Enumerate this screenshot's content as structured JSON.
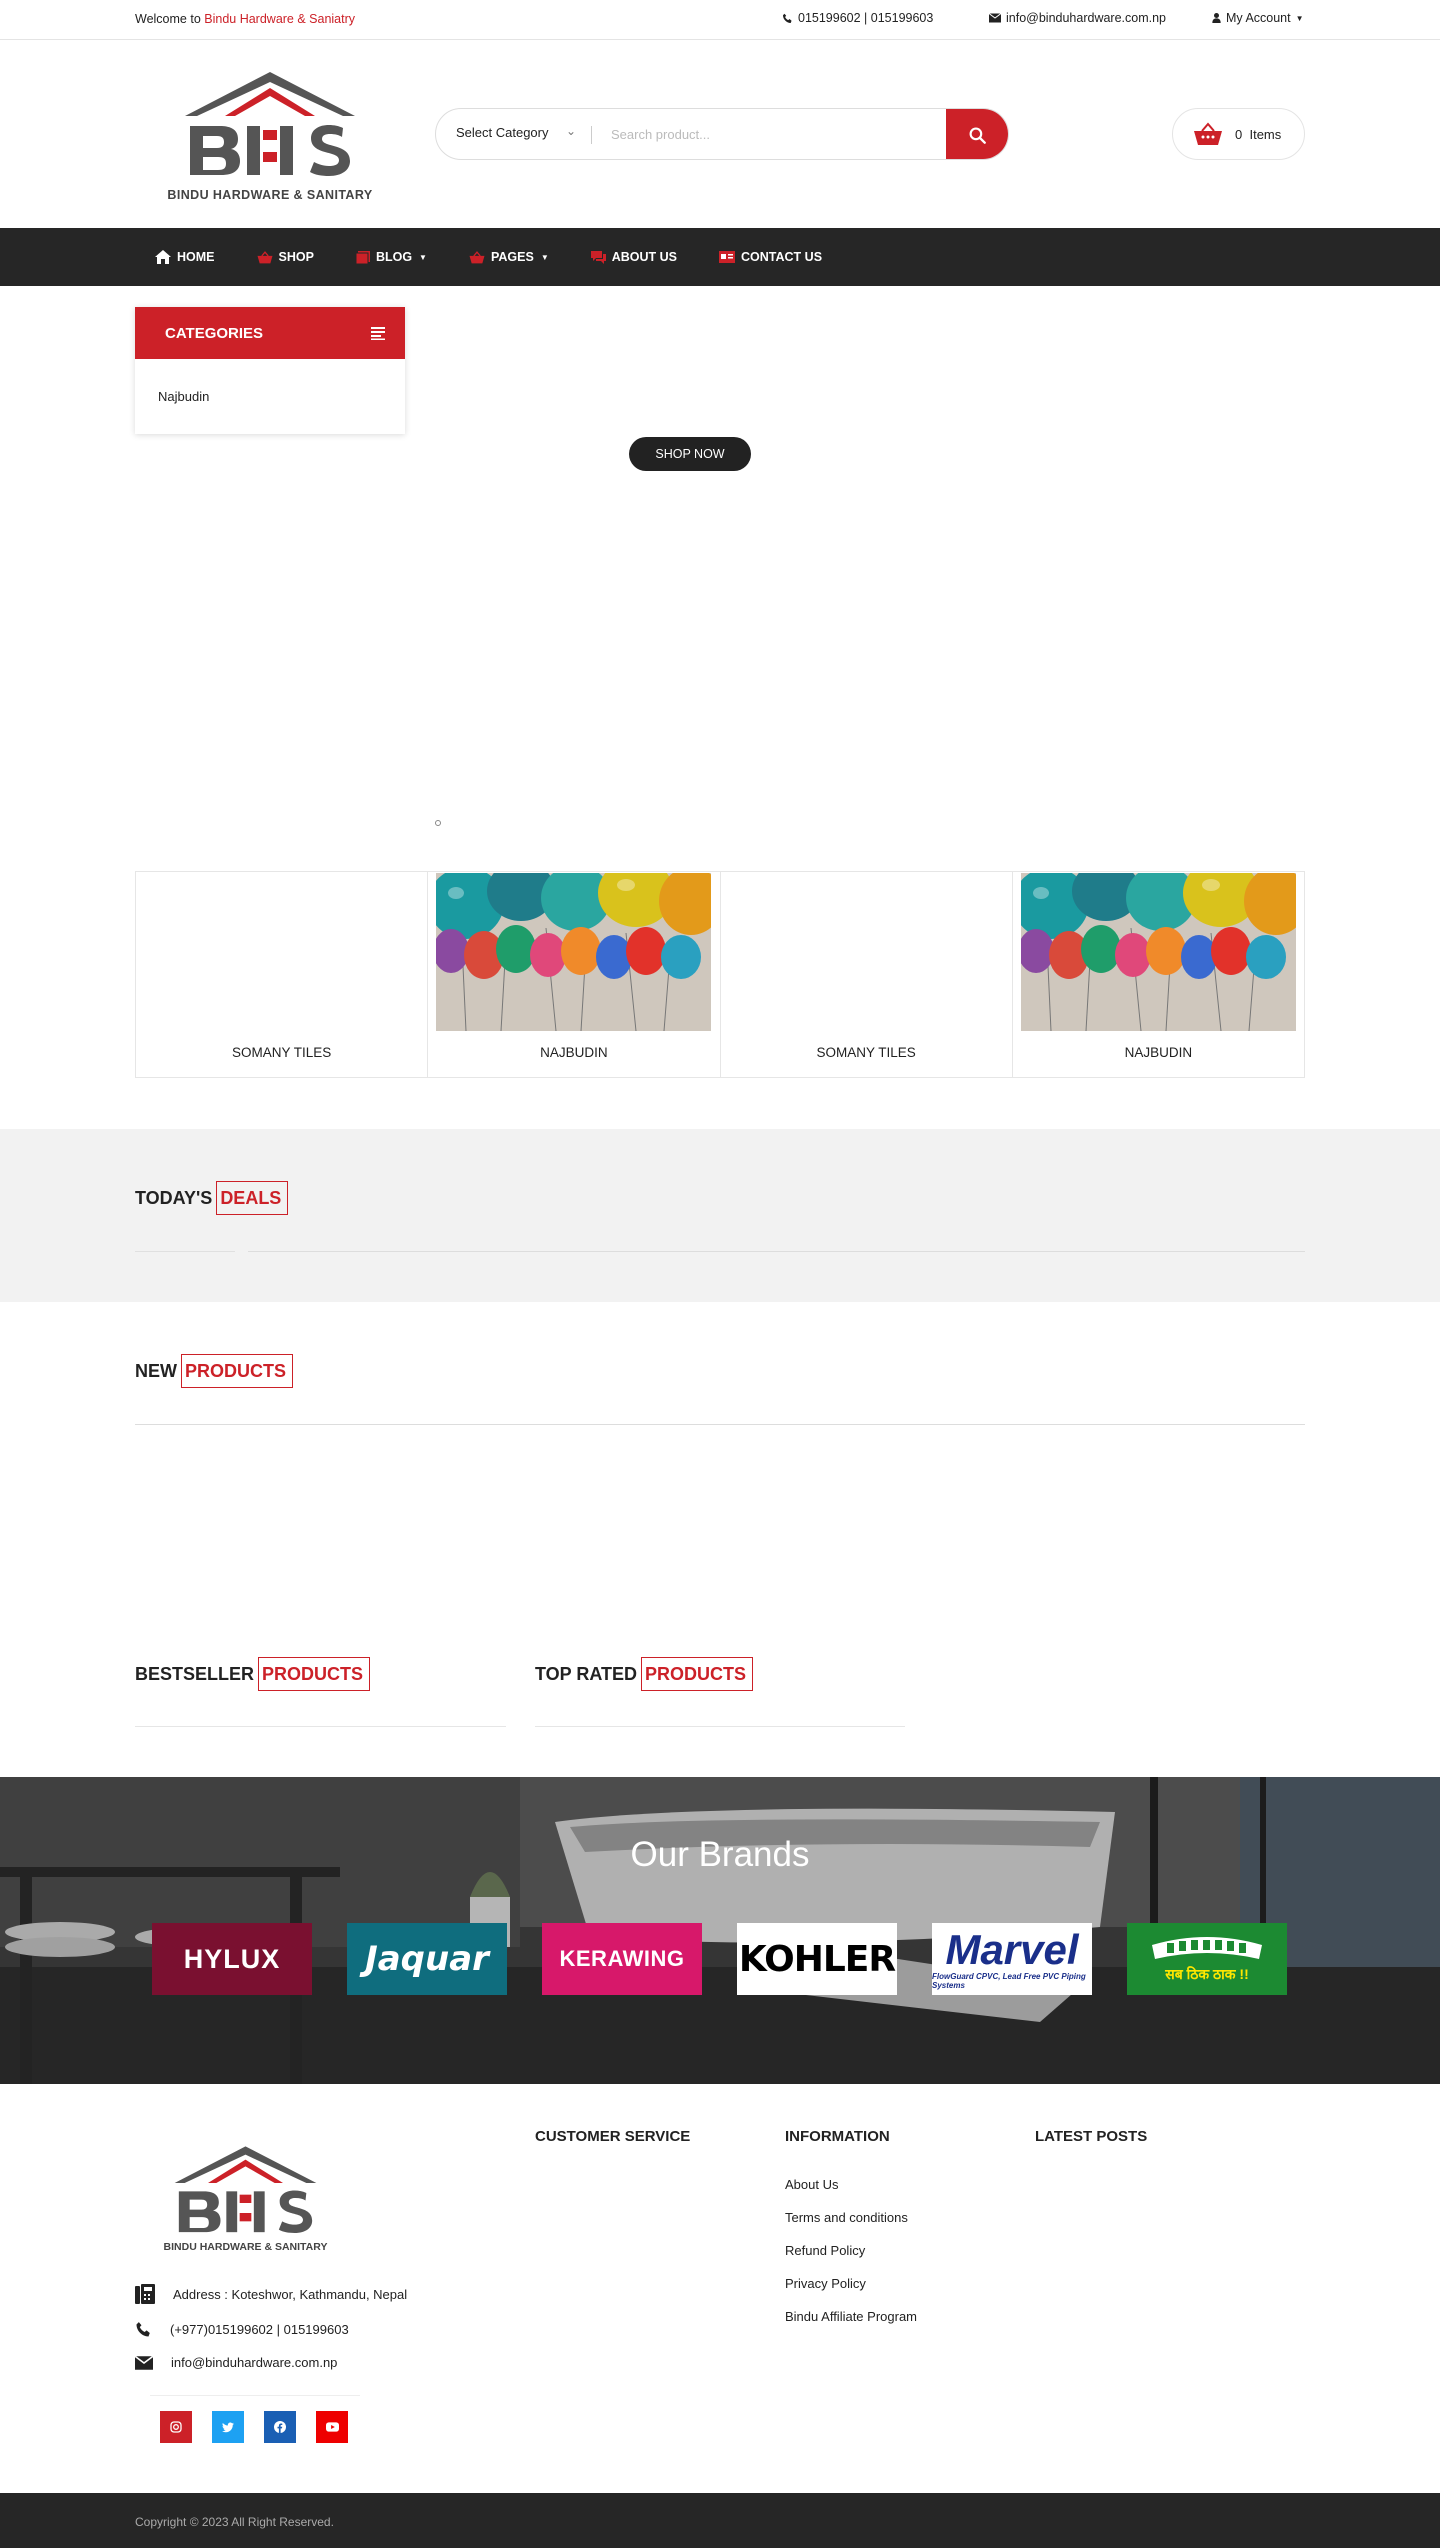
{
  "topbar": {
    "welcome_prefix": "Welcome to",
    "store_name": "Bindu Hardware & Saniatry",
    "phone": "015199602 | 015199603",
    "email": "info@binduhardware.com.np",
    "account": "My Account"
  },
  "header": {
    "logo_text": "BINDU HARDWARE & SANITARY",
    "select_category": "Select Category",
    "search_placeholder": "Search product...",
    "cart_count": "0",
    "cart_label": "Items"
  },
  "nav": {
    "items": [
      {
        "label": "HOME",
        "icon": "home-icon"
      },
      {
        "label": "SHOP",
        "icon": "basket-icon"
      },
      {
        "label": "BLOG",
        "icon": "book-icon"
      },
      {
        "label": "PAGES",
        "icon": "basket-icon"
      },
      {
        "label": "ABOUT US",
        "icon": "chat-icon"
      },
      {
        "label": "CONTACT US",
        "icon": "card-icon"
      }
    ]
  },
  "categories": {
    "title": "CATEGORIES",
    "items": [
      "Najbudin"
    ]
  },
  "hero": {
    "button": "SHOP NOW"
  },
  "featured": [
    {
      "label": "SOMANY TILES",
      "has_image": false
    },
    {
      "label": "NAJBUDIN",
      "has_image": true
    },
    {
      "label": "SOMANY TILES",
      "has_image": false
    },
    {
      "label": "NAJBUDIN",
      "has_image": true
    }
  ],
  "sections": {
    "deals": {
      "prefix": "TODAY'S",
      "highlight": "DEALS"
    },
    "new_products": {
      "prefix": "NEW",
      "highlight": "PRODUCTS"
    },
    "bestseller": {
      "prefix": "BESTSELLER",
      "highlight": "PRODUCTS"
    },
    "top_rated": {
      "prefix": "TOP RATED",
      "highlight": "PRODUCTS"
    }
  },
  "brands": {
    "title": "Our Brands",
    "items": [
      {
        "name": "HYLUX",
        "bg": "#7a1030",
        "color": "#ffffff"
      },
      {
        "name": "Jaquar",
        "bg": "#0f6d7e",
        "color": "#ffffff"
      },
      {
        "name": "KERAWING",
        "bg": "#d7186a",
        "color": "#ffffff"
      },
      {
        "name": "KOHLER",
        "bg": "#ffffff",
        "color": "#000000"
      },
      {
        "name": "Marvel",
        "sub": "FlowGuard CPVC, Lead Free PVC Piping Systems",
        "bg": "#ffffff",
        "color": "#1a2f8a"
      },
      {
        "name": "सब ठिक ठाक !!",
        "bg": "#1c8a32",
        "color": "#ffe600"
      }
    ]
  },
  "footer": {
    "logo_text": "BINDU HARDWARE & SANITARY",
    "address": "Address : Koteshwor, Kathmandu, Nepal",
    "phone": "(+977)015199602 | 015199603",
    "email": "info@binduhardware.com.np",
    "customer_service": "CUSTOMER SERVICE",
    "information": "INFORMATION",
    "latest_posts": "LATEST POSTS",
    "info_links": [
      "About Us",
      "Terms and conditions",
      "Refund Policy",
      "Privacy Policy",
      "Bindu Affiliate Program"
    ],
    "social": [
      {
        "name": "instagram",
        "color": "#cc2128"
      },
      {
        "name": "twitter",
        "color": "#1da1f2"
      },
      {
        "name": "facebook",
        "color": "#1a5fb4"
      },
      {
        "name": "youtube",
        "color": "#ee0000"
      }
    ],
    "copyright": "Copyright © 2023 All Right Reserved."
  },
  "colors": {
    "accent": "#cc2128",
    "dark": "#262626"
  }
}
